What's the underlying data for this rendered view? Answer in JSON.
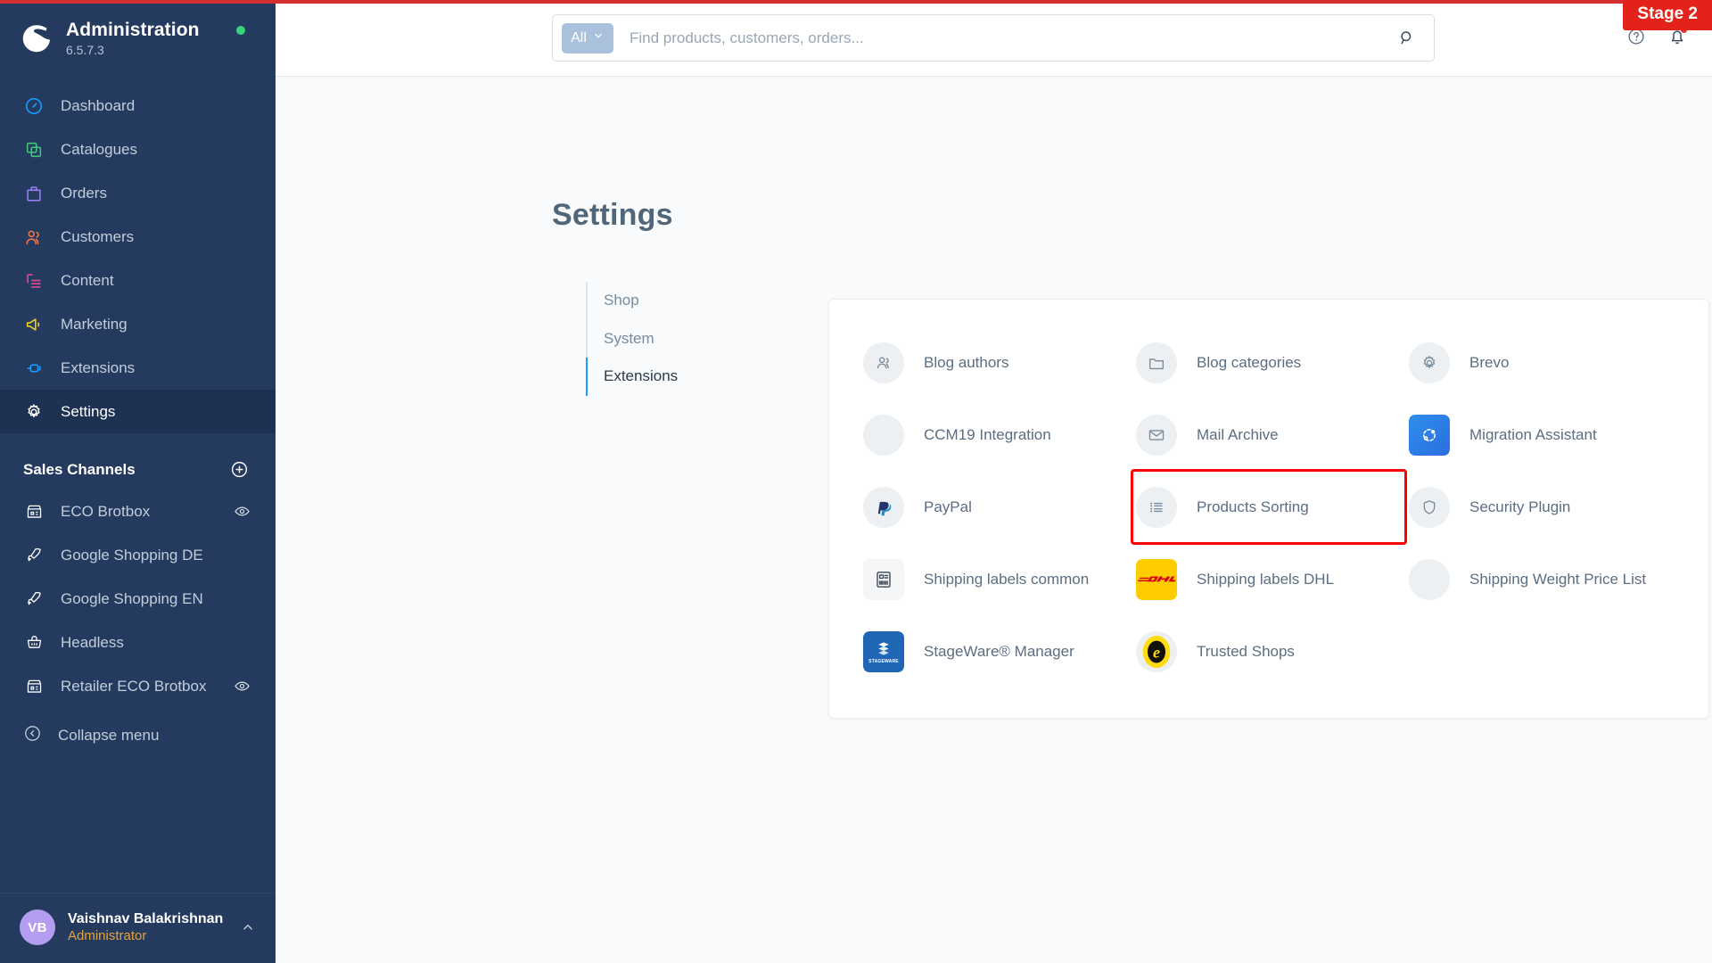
{
  "brand": {
    "title": "Administration",
    "version": "6.5.7.3",
    "logo_icon": "shopware-logo-icon",
    "status_dot_color": "#37d67a"
  },
  "stage_badge": {
    "label": "Stage 2",
    "color": "#e3231b"
  },
  "search": {
    "scope_label": "All",
    "scope_caret_icon": "chevron-down-icon",
    "placeholder": "Find products, customers, orders...",
    "value": "",
    "search_icon": "search-icon"
  },
  "topbar": {
    "help_icon": "question-circle-icon",
    "notifications_icon": "bell-icon",
    "notification_dot_color": "#e3372a"
  },
  "sidebar": {
    "items": [
      {
        "label": "Dashboard",
        "icon": "dashboard-icon",
        "color": "#189eff",
        "active": false
      },
      {
        "label": "Catalogues",
        "icon": "catalogues-icon",
        "color": "#3ec97c",
        "active": false
      },
      {
        "label": "Orders",
        "icon": "orders-icon",
        "color": "#9b7df0",
        "active": false
      },
      {
        "label": "Customers",
        "icon": "customers-icon",
        "color": "#f07a46",
        "active": false
      },
      {
        "label": "Content",
        "icon": "content-icon",
        "color": "#ec4899",
        "active": false
      },
      {
        "label": "Marketing",
        "icon": "marketing-icon",
        "color": "#f2d024",
        "active": false
      },
      {
        "label": "Extensions",
        "icon": "extensions-icon",
        "color": "#189eff",
        "active": false
      },
      {
        "label": "Settings",
        "icon": "settings-gear-icon",
        "color": "#ffffff",
        "active": true
      }
    ],
    "sales_channels": {
      "title": "Sales Channels",
      "add_icon": "plus-circle-icon",
      "items": [
        {
          "label": "ECO Brotbox",
          "icon": "storefront-icon",
          "eye": true
        },
        {
          "label": "Google Shopping DE",
          "icon": "rocket-icon",
          "eye": false
        },
        {
          "label": "Google Shopping EN",
          "icon": "rocket-icon",
          "eye": false
        },
        {
          "label": "Headless",
          "icon": "basket-icon",
          "eye": false
        },
        {
          "label": "Retailer ECO Brotbox",
          "icon": "storefront-icon",
          "eye": true
        }
      ]
    },
    "collapse": {
      "label": "Collapse menu",
      "icon": "chevron-left-circle-icon"
    },
    "user": {
      "initials": "VB",
      "name": "Vaishnav Balakrishnan",
      "role": "Administrator",
      "caret_icon": "chevron-up-icon",
      "avatar_color": "#b49df0",
      "role_color": "#e8a33d"
    }
  },
  "page": {
    "title": "Settings",
    "subnav": [
      {
        "label": "Shop",
        "active": false
      },
      {
        "label": "System",
        "active": false
      },
      {
        "label": "Extensions",
        "active": true
      }
    ]
  },
  "extensions": [
    {
      "label": "Blog authors",
      "icon": "users-icon",
      "style": "circle"
    },
    {
      "label": "Blog categories",
      "icon": "folder-icon",
      "style": "circle"
    },
    {
      "label": "Brevo",
      "icon": "gear-icon",
      "style": "circle"
    },
    {
      "label": "CCM19 Integration",
      "icon": "blank-icon",
      "style": "blank"
    },
    {
      "label": "Mail Archive",
      "icon": "envelope-icon",
      "style": "circle"
    },
    {
      "label": "Migration Assistant",
      "icon": "migration-icon",
      "style": "tile-migration"
    },
    {
      "label": "PayPal",
      "icon": "paypal-icon",
      "style": "circle"
    },
    {
      "label": "Products Sorting",
      "icon": "list-icon",
      "style": "circle",
      "highlighted": true
    },
    {
      "label": "Security Plugin",
      "icon": "shield-icon",
      "style": "circle"
    },
    {
      "label": "Shipping labels common",
      "icon": "label-barcode-icon",
      "style": "tile-shipcommon"
    },
    {
      "label": "Shipping labels DHL",
      "icon": "dhl-logo-icon",
      "style": "tile-dhl",
      "brand_text": "DHL"
    },
    {
      "label": "Shipping Weight Price List",
      "icon": "blank-icon",
      "style": "blank"
    },
    {
      "label": "StageWare® Manager",
      "icon": "stageware-logo-icon",
      "style": "tile-stageware",
      "brand_text": "STAGEWARE"
    },
    {
      "label": "Trusted Shops",
      "icon": "trusted-shops-icon",
      "style": "circle"
    }
  ],
  "highlight_color": "#ff0000"
}
